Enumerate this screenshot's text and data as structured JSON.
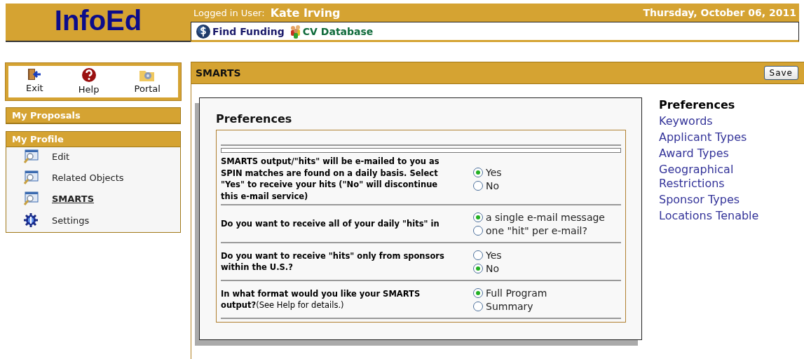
{
  "header": {
    "logo": "InfoEd",
    "user_label": "Logged in User:",
    "user_name": "Kate Irving",
    "date": "Thursday, October 06, 2011",
    "nav_links": [
      {
        "label": "Find Funding",
        "kind": "funding"
      },
      {
        "label": "CV Database",
        "kind": "cv"
      }
    ]
  },
  "toolbar": [
    {
      "label": "Exit",
      "kind": "exit"
    },
    {
      "label": "Help",
      "kind": "help"
    },
    {
      "label": "Portal",
      "kind": "portal"
    }
  ],
  "sections": [
    {
      "title": "My Proposals"
    },
    {
      "title": "My Profile",
      "items": [
        {
          "label": "Edit",
          "kind": "view",
          "selected": false
        },
        {
          "label": "Related Objects",
          "kind": "view",
          "selected": false
        },
        {
          "label": "SMARTS",
          "kind": "view",
          "selected": true
        },
        {
          "label": "Settings",
          "kind": "settings",
          "selected": false
        }
      ]
    }
  ],
  "panel": {
    "title": "SMARTS",
    "save_button": "Save",
    "form": {
      "heading": "Preferences",
      "questions": [
        {
          "text": "**SMARTS output/\"hits\" will be e-mailed to you as SPIN matches are found on a daily basis. Select \"Yes\" to receive your hits (\"No\" will discontinue this e-mail service)**",
          "options": [
            {
              "label": "Yes",
              "selected": true
            },
            {
              "label": "No",
              "selected": false
            }
          ]
        },
        {
          "text": "**Do you want to receive all of your daily \"hits\" in**",
          "options": [
            {
              "label": "a single e-mail message",
              "selected": true
            },
            {
              "label": "one \"hit\" per e-mail?",
              "selected": false
            }
          ]
        },
        {
          "text": "**Do you want to receive \"hits\" only from sponsors within the U.S.?**",
          "options": [
            {
              "label": "Yes",
              "selected": false
            },
            {
              "label": "No",
              "selected": true
            }
          ]
        },
        {
          "text": "**In what format would you like your SMARTS output?**(See Help for details.)",
          "options": [
            {
              "label": "Full Program",
              "selected": true
            },
            {
              "label": "Summary",
              "selected": false
            }
          ]
        }
      ]
    },
    "side_nav": [
      {
        "label": "Preferences",
        "selected": true
      },
      {
        "label": "Keywords",
        "selected": false
      },
      {
        "label": "Applicant Types",
        "selected": false
      },
      {
        "label": "Award Types",
        "selected": false
      },
      {
        "label": "Geographical Restrictions",
        "selected": false
      },
      {
        "label": "Sponsor Types",
        "selected": false
      },
      {
        "label": "Locations Tenable",
        "selected": false
      }
    ]
  }
}
